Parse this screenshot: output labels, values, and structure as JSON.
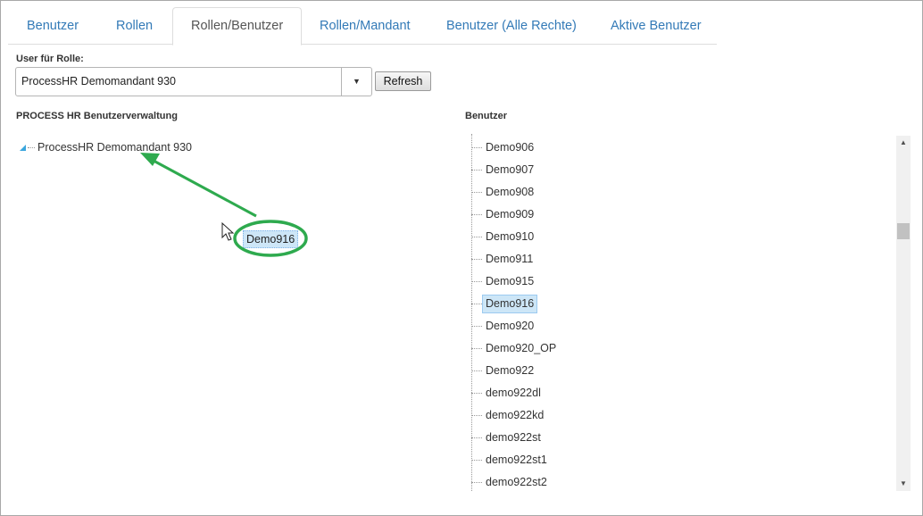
{
  "tabs": [
    {
      "label": "Benutzer",
      "active": false
    },
    {
      "label": "Rollen",
      "active": false
    },
    {
      "label": "Rollen/Benutzer",
      "active": true
    },
    {
      "label": "Rollen/Mandant",
      "active": false
    },
    {
      "label": "Benutzer (Alle Rechte)",
      "active": false
    },
    {
      "label": "Aktive Benutzer",
      "active": false
    }
  ],
  "role_selector": {
    "label": "User für Rolle:",
    "selected": "ProcessHR Demomandant 930",
    "arrow_icon": "triangle-down-icon",
    "refresh_label": "Refresh"
  },
  "left_panel": {
    "title": "PROCESS HR Benutzerverwaltung",
    "tree_root": "ProcessHR Demomandant 930",
    "toggle_icon": "expand-triangle-icon"
  },
  "drag": {
    "item_label": "Demo916",
    "cursor_icon": "mouse-pointer-icon",
    "annotation_color": "#2eaa4e"
  },
  "right_panel": {
    "title": "Benutzer",
    "users": [
      "Demo906",
      "Demo907",
      "Demo908",
      "Demo909",
      "Demo910",
      "Demo911",
      "Demo915",
      "Demo916",
      "Demo920",
      "Demo920_OP",
      "Demo922",
      "demo922dl",
      "demo922kd",
      "demo922st",
      "demo922st1",
      "demo922st2"
    ],
    "selected_user": "Demo916"
  },
  "colors": {
    "tab_link": "#337ab7",
    "selection": "#cde6f7",
    "annotation": "#2eaa4e"
  }
}
